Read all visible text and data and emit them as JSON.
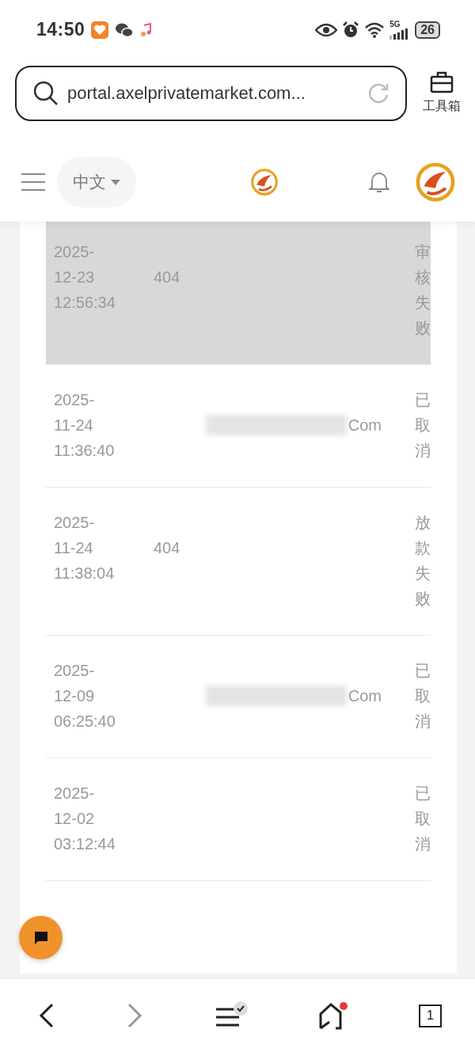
{
  "status_bar": {
    "time": "14:50",
    "network": "5G",
    "battery": "26"
  },
  "browser": {
    "url": "portal.axelprivatemarket.com...",
    "toolbox_label": "工具箱"
  },
  "header": {
    "language": "中文"
  },
  "records": [
    {
      "date_lines": [
        "2025-",
        "12-23",
        "12:56:34"
      ],
      "col2": "404",
      "col2_redacted": false,
      "status": "审核失败",
      "selected": true
    },
    {
      "date_lines": [
        "2025-",
        "11-24",
        "11:36:40"
      ],
      "col2": "Com",
      "col2_redacted": true,
      "status": "已取消",
      "selected": false
    },
    {
      "date_lines": [
        "2025-",
        "11-24",
        "11:38:04"
      ],
      "col2": "404",
      "col2_redacted": false,
      "status": "放款失败",
      "selected": false
    },
    {
      "date_lines": [
        "2025-",
        "12-09",
        "06:25:40"
      ],
      "col2": "Com",
      "col2_redacted": true,
      "status": "已取消",
      "selected": false
    },
    {
      "date_lines": [
        "2025-",
        "12-02",
        "03:12:44"
      ],
      "col2_redacted": false,
      "status": "已取消",
      "selected": false
    }
  ],
  "bottom_nav": {
    "tabs_count": "1",
    "home_notification": true,
    "menu_checked": true
  }
}
